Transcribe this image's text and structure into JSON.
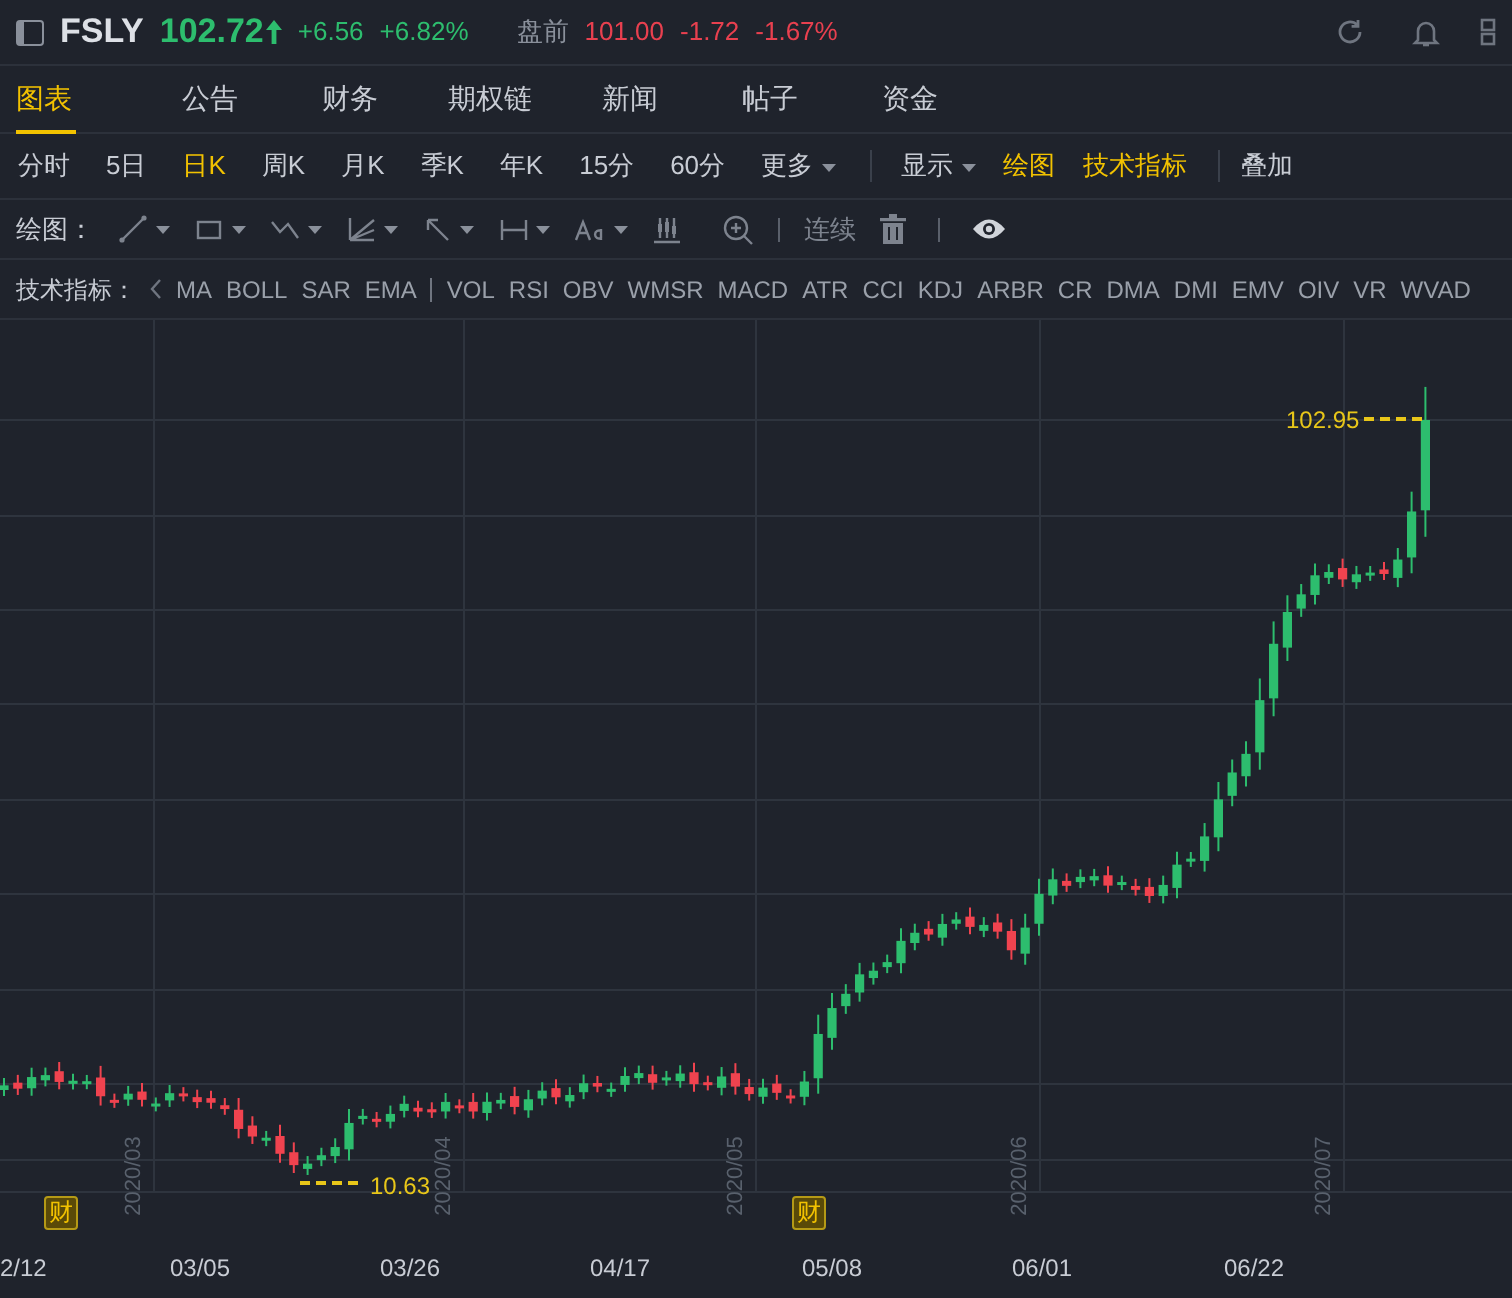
{
  "quote": {
    "symbol": "FSLY",
    "price": "102.72",
    "change": "+6.56",
    "change_pct": "+6.82%",
    "premarket_label": "盘前",
    "premarket_price": "101.00",
    "premarket_change": "-1.72",
    "premarket_pct": "-1.67%"
  },
  "tabs": [
    {
      "label": "图表",
      "selected": true
    },
    {
      "label": "公告",
      "selected": false
    },
    {
      "label": "财务",
      "selected": false
    },
    {
      "label": "期权链",
      "selected": false
    },
    {
      "label": "新闻",
      "selected": false
    },
    {
      "label": "帖子",
      "selected": false
    },
    {
      "label": "资金",
      "selected": false
    }
  ],
  "periods": [
    {
      "label": "分时",
      "selected": false
    },
    {
      "label": "5日",
      "selected": false
    },
    {
      "label": "日K",
      "selected": true
    },
    {
      "label": "周K",
      "selected": false
    },
    {
      "label": "月K",
      "selected": false
    },
    {
      "label": "季K",
      "selected": false
    },
    {
      "label": "年K",
      "selected": false
    },
    {
      "label": "15分",
      "selected": false
    },
    {
      "label": "60分",
      "selected": false
    },
    {
      "label": "更多",
      "selected": false,
      "dropdown": true
    }
  ],
  "view_controls": [
    {
      "label": "显示",
      "active": false,
      "dropdown": true
    },
    {
      "label": "绘图",
      "active": true,
      "dropdown": false
    },
    {
      "label": "技术指标",
      "active": true,
      "dropdown": false
    }
  ],
  "overlay": "叠加",
  "drawing_bar": {
    "label": "绘图：",
    "continuous": "连续"
  },
  "indicator_bar": {
    "label": "技术指标：",
    "main": [
      "MA",
      "BOLL",
      "SAR",
      "EMA"
    ],
    "sub": [
      "VOL",
      "RSI",
      "OBV",
      "WMSR",
      "MACD",
      "ATR",
      "CCI",
      "KDJ",
      "ARBR",
      "CR",
      "DMA",
      "DMI",
      "EMV",
      "OIV",
      "VR",
      "WVAD"
    ]
  },
  "chart": {
    "high_label": "102.95",
    "low_label": "10.63",
    "month_labels": [
      "2020/03",
      "2020/04",
      "2020/05",
      "2020/06",
      "2020/07"
    ],
    "earnings_markers": [
      "财",
      "财"
    ],
    "x_labels": [
      "2/12",
      "03/05",
      "03/26",
      "04/17",
      "05/08",
      "06/01",
      "06/22"
    ]
  }
}
